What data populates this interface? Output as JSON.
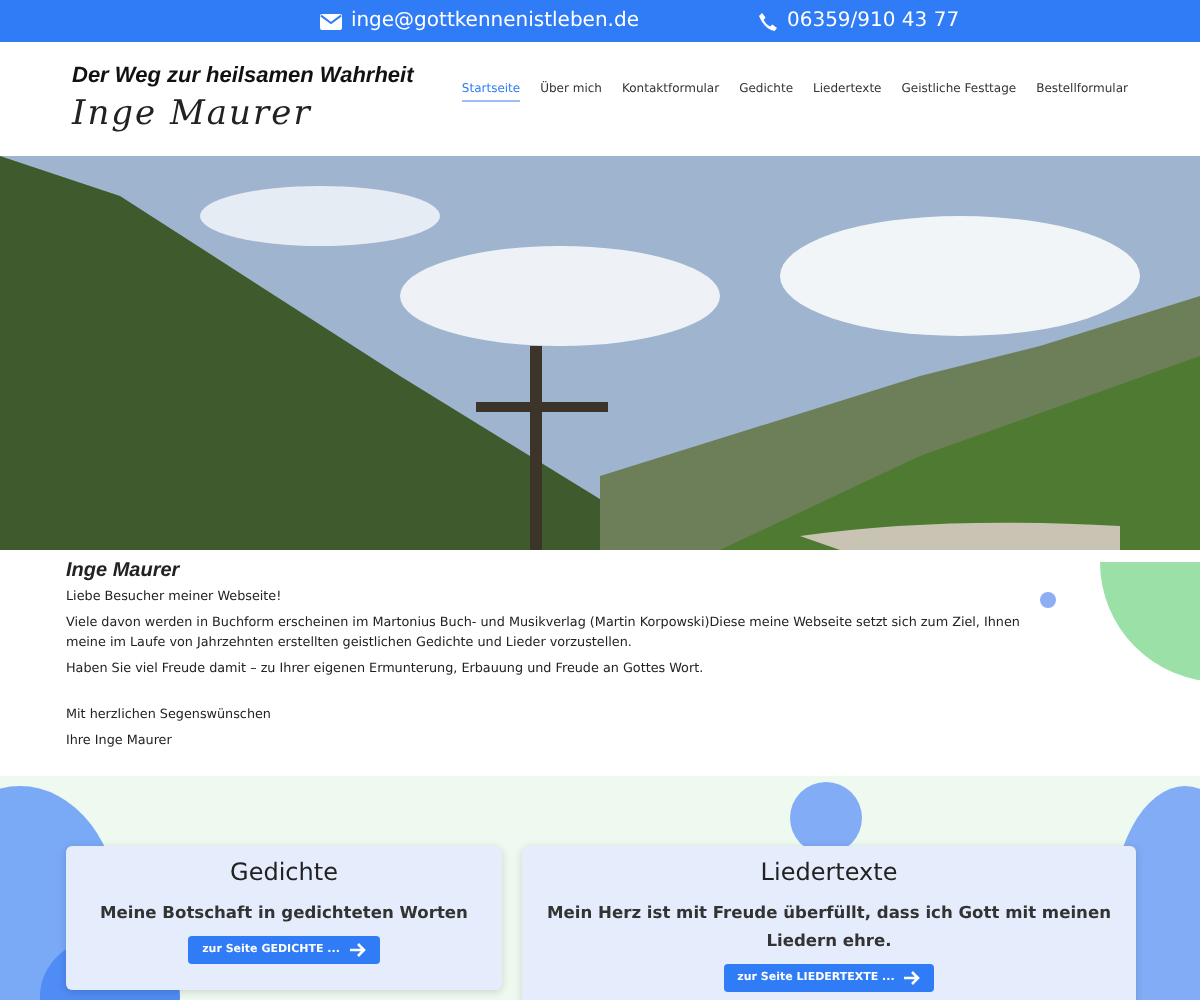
{
  "top_bar": {
    "email": "inge@gottkennenistleben.de",
    "phone": "06359/910 43 77"
  },
  "header": {
    "tagline": "Der Weg zur heilsamen Wahrheit",
    "logo": "Inge Maurer",
    "nav": [
      {
        "label": "Startseite",
        "selected": true
      },
      {
        "label": "Über mich",
        "selected": false
      },
      {
        "label": "Kontaktformular",
        "selected": false
      },
      {
        "label": "Gedichte",
        "selected": false
      },
      {
        "label": "Liedertexte",
        "selected": false
      },
      {
        "label": "Geistliche Festtage",
        "selected": false
      },
      {
        "label": "Bestellformular",
        "selected": false
      }
    ]
  },
  "intro": {
    "title": "Inge Maurer",
    "paragraphs": [
      "Liebe Besucher meiner Webseite!",
      "Viele davon werden in Buchform erscheinen im Martonius Buch- und Musikverlag (Martin Korpowski)Diese meine Webseite setzt sich zum Ziel, Ihnen meine im Laufe von Jahrzehnten erstellten geistlichen Gedichte und Lieder vorzustellen.",
      "Haben Sie viel Freude damit – zu Ihrer eigenen Ermunterung, Erbauung und Freude an Gottes Wort."
    ],
    "closing": [
      "Mit herzlichen Segenswünschen",
      "Ihre Inge Maurer"
    ]
  },
  "cards": [
    {
      "title": "Gedichte",
      "text": "Meine Botschaft in gedichteten Worten",
      "button": "zur Seite GEDICHTE ..."
    },
    {
      "title": "Liedertexte",
      "text": "Mein Herz ist mit Freude überfüllt, dass ich Gott mit meinen Liedern ehre.",
      "button": "zur Seite LIEDERTEXTE ..."
    }
  ]
}
